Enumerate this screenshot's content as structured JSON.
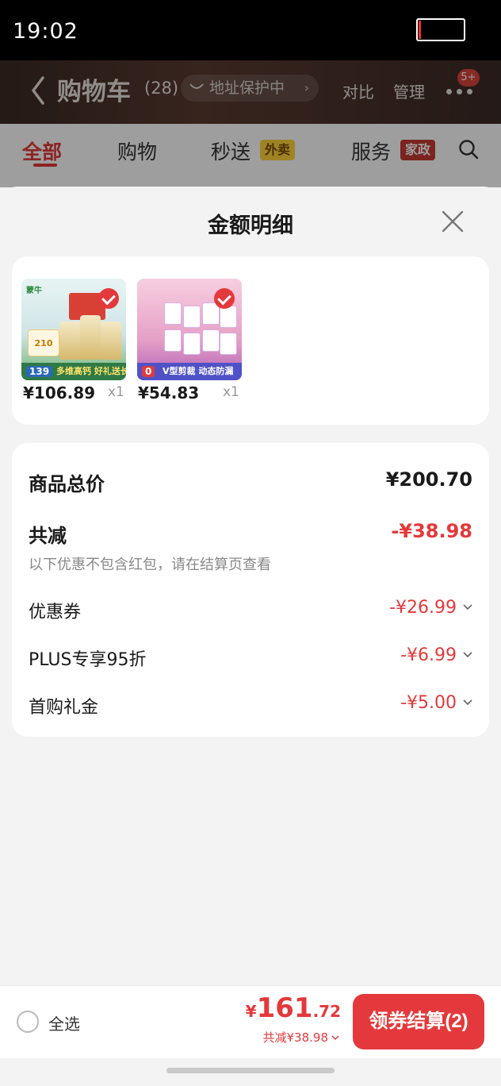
{
  "status_bar": {
    "time": "19:02"
  },
  "header": {
    "title": "购物车",
    "count": "(28)",
    "address_protection": "地址保护中",
    "compare": "对比",
    "manage": "管理",
    "badge": "5+"
  },
  "tabs": {
    "all": "全部",
    "shopping": "购物",
    "express": "秒送",
    "express_tag": "外卖",
    "service": "服务",
    "service_tag": "家政"
  },
  "sheet": {
    "title": "金额明细",
    "products": [
      {
        "price": "¥106.89",
        "qty": "x1",
        "brand": "蒙牛",
        "chip": "139",
        "band": "多维高钙 好礼送长辈",
        "coupon": "210"
      },
      {
        "price": "¥54.83",
        "qty": "x1",
        "chip": "0",
        "band": "V型剪裁 动态防漏"
      }
    ],
    "total_label": "商品总价",
    "total_value": "¥200.70",
    "reduce_label": "共减",
    "reduce_value": "-¥38.98",
    "note": "以下优惠不包含红包，请在结算页查看",
    "discounts": [
      {
        "label": "优惠券",
        "value": "-¥26.99"
      },
      {
        "label": "PLUS专享95折",
        "value": "-¥6.99"
      },
      {
        "label": "首购礼金",
        "value": "-¥5.00"
      }
    ]
  },
  "bottom_bar": {
    "select_all": "全选",
    "currency": "¥",
    "amount_int": "161",
    "amount_dec": ".72",
    "reduce_text": "共减¥38.98",
    "checkout": "领券结算(2)"
  },
  "colors": {
    "accent": "#e4393c",
    "header_bg": "#4a322b"
  }
}
